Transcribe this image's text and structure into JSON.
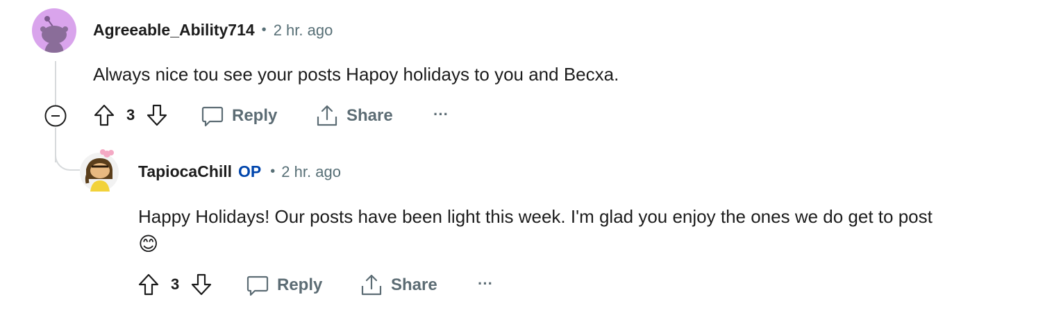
{
  "comments": [
    {
      "username": "Agreeable_Ability714",
      "separator": "•",
      "time": "2 hr. ago",
      "text": "Always nice tou see your posts Hapoy holidays to you and Becxa.",
      "votes": "3",
      "reply_label": "Reply",
      "share_label": "Share",
      "more_label": "···"
    },
    {
      "username": "TapiocaChill",
      "op_badge": "OP",
      "separator": "•",
      "time": "2 hr. ago",
      "text": "Happy Holidays! Our posts have been light this week. I'm glad you enjoy the ones we do get to post",
      "emoji": "😊",
      "votes": "3",
      "reply_label": "Reply",
      "share_label": "Share",
      "more_label": "···"
    }
  ],
  "colors": {
    "avatar_bg": "#d9a4ec",
    "thread_line": "#d7dadc",
    "meta": "#576f76",
    "op": "#0045ac"
  }
}
